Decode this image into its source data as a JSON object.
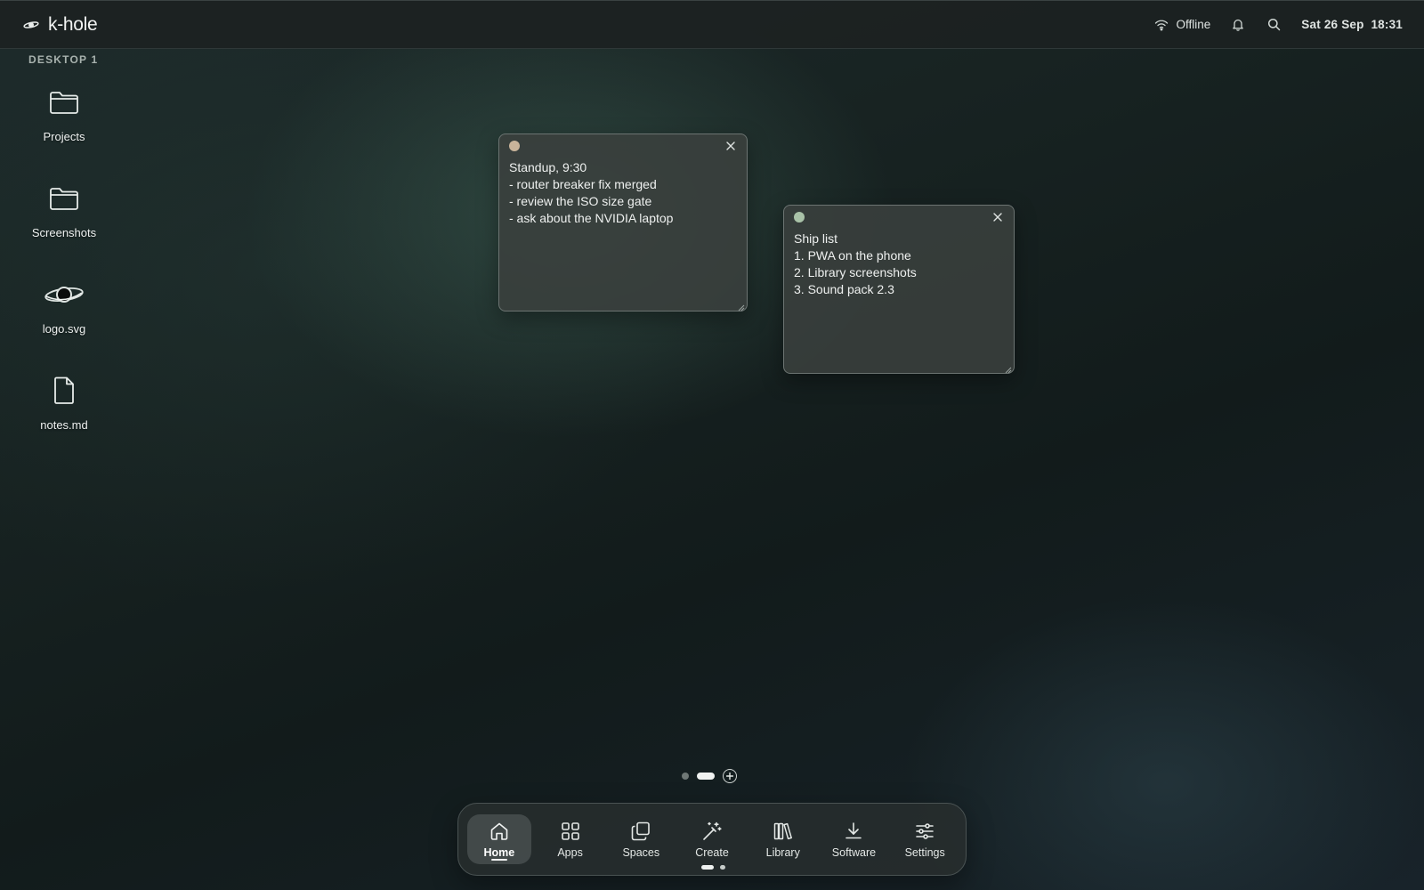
{
  "topbar": {
    "brand": "k-hole",
    "brand_icon": "planet-ring-icon",
    "network_label": "Offline",
    "network_icon": "wifi-icon",
    "notifications_icon": "bell-icon",
    "search_icon": "search-icon",
    "clock": "Sat 26 Sep  18:31"
  },
  "desktop": {
    "label": "DESKTOP 1",
    "icons": [
      {
        "label": "Projects",
        "icon": "folder-icon"
      },
      {
        "label": "Screenshots",
        "icon": "folder-icon"
      },
      {
        "label": "logo.svg",
        "icon": "black-hole-icon"
      },
      {
        "label": "notes.md",
        "icon": "file-icon"
      }
    ]
  },
  "notes": [
    {
      "dot_color": "#c9b49a",
      "text": "Standup, 9:30\n- router breaker fix merged\n- review the ISO size gate\n- ask about the NVIDIA laptop"
    },
    {
      "dot_color": "#a9c2a8",
      "text": "Ship list\n1. PWA on the phone\n2. Library screenshots\n3. Sound pack 2.3"
    }
  ],
  "pages": {
    "count": 2,
    "active": 2
  },
  "dock": {
    "items": [
      {
        "label": "Home",
        "icon": "home-icon",
        "active": true
      },
      {
        "label": "Apps",
        "icon": "grid-icon"
      },
      {
        "label": "Spaces",
        "icon": "copy-squares-icon"
      },
      {
        "label": "Create",
        "icon": "magic-wand-icon"
      },
      {
        "label": "Library",
        "icon": "library-books-icon"
      },
      {
        "label": "Software",
        "icon": "download-icon"
      },
      {
        "label": "Settings",
        "icon": "sliders-icon"
      }
    ],
    "pager": {
      "count": 2,
      "active": 1
    }
  }
}
